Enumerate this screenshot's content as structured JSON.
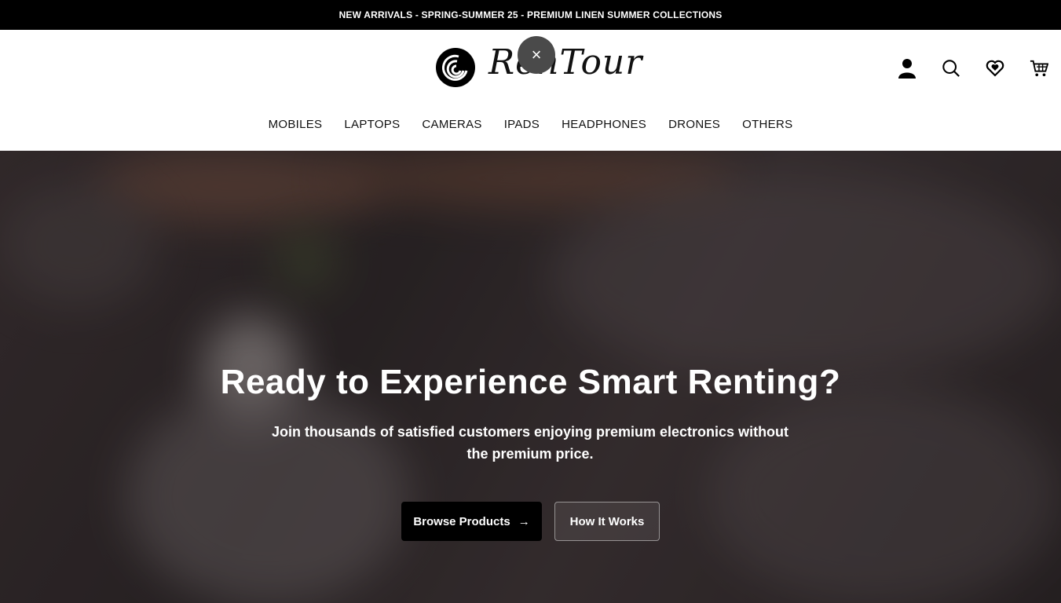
{
  "announcement": "NEW ARRIVALS - SPRING-SUMMER 25 - PREMIUM LINEN SUMMER COLLECTIONS",
  "logo": {
    "text": "RenTour"
  },
  "header": {
    "close_label": "×",
    "icons": [
      "user-icon",
      "search-icon",
      "wishlist-icon",
      "cart-icon"
    ]
  },
  "nav": {
    "items": [
      {
        "label": "MOBILES"
      },
      {
        "label": "LAPTOPS"
      },
      {
        "label": "CAMERAS"
      },
      {
        "label": "IPADS"
      },
      {
        "label": "HEADPHONES"
      },
      {
        "label": "DRONES"
      },
      {
        "label": "OTHERS"
      }
    ]
  },
  "hero": {
    "title": "Ready to Experience Smart Renting?",
    "subtitle": "Join thousands of satisfied customers enjoying premium electronics without the premium price.",
    "primary_button": "Browse Products",
    "primary_arrow": "→",
    "secondary_button": "How It Works"
  },
  "colors": {
    "announcement_bg": "#000000",
    "primary_button_bg": "#000000",
    "close_button_bg": "#4a4a4a"
  }
}
